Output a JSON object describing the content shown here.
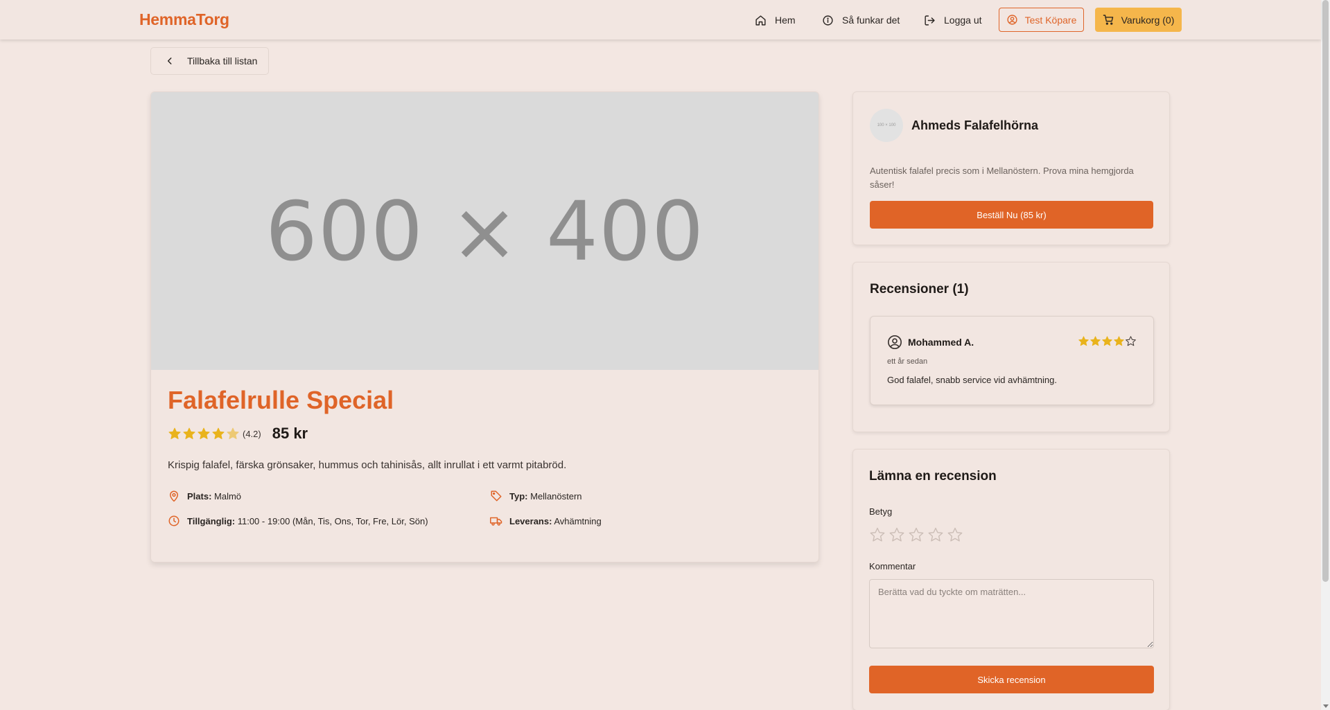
{
  "header": {
    "logo": "HemmaTorg",
    "nav": {
      "home": "Hem",
      "how_it_works": "Så funkar det",
      "logout": "Logga ut",
      "profile": "Test Köpare",
      "cart": "Varukorg (0)"
    }
  },
  "back_button": "Tillbaka till listan",
  "product": {
    "image_placeholder": "600 × 400",
    "title": "Falafelrulle Special",
    "rating": 4.2,
    "rating_label": "(4.2)",
    "price": "85 kr",
    "description": "Krispig falafel, färska grönsaker, hummus och tahinisås, allt inrullat i ett varmt pitabröd.",
    "details": {
      "location_label": "Plats:",
      "location": "Malmö",
      "type_label": "Typ:",
      "type": "Mellanöstern",
      "availability_label": "Tillgänglig:",
      "availability": "11:00 - 19:00 (Mån, Tis, Ons, Tor, Fre, Lör, Sön)",
      "delivery_label": "Leverans:",
      "delivery": "Avhämtning"
    }
  },
  "seller": {
    "avatar_placeholder": "100 × 100",
    "name": "Ahmeds Falafelhörna",
    "description": "Autentisk falafel precis som i Mellanöstern. Prova mina hemgjorda såser!",
    "order_button": "Beställ Nu (85 kr)"
  },
  "reviews": {
    "title": "Recensioner (1)",
    "items": [
      {
        "author": "Mohammed A.",
        "rating": 4,
        "time": "ett år sedan",
        "text": "God falafel, snabb service vid avhämtning."
      }
    ]
  },
  "review_form": {
    "title": "Lämna en recension",
    "rating_label": "Betyg",
    "comment_label": "Kommentar",
    "comment_placeholder": "Berätta vad du tyckte om maträtten...",
    "comment_value": "",
    "submit_button": "Skicka recension"
  },
  "colors": {
    "accent": "#df6428",
    "star": "#e9b31c",
    "cart_button": "#f5b64b",
    "background": "#f3e7e2"
  },
  "icons": {
    "home": "home-icon",
    "info": "info-icon",
    "logout": "logout-icon",
    "user": "user-circle-icon",
    "cart": "cart-icon",
    "back": "chevron-left-icon",
    "location": "map-pin-icon",
    "type": "tag-icon",
    "time": "clock-icon",
    "delivery": "truck-icon"
  }
}
